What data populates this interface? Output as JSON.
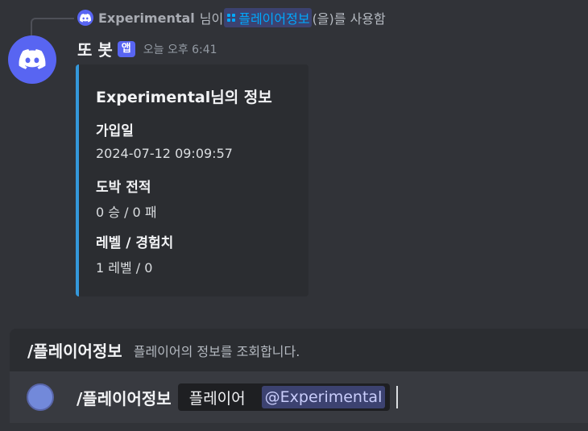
{
  "reply": {
    "user": "Experimental",
    "text_before": "님이",
    "command": "플레이어정보",
    "text_after": "(을)를 사용함"
  },
  "message": {
    "username": "또 봇",
    "app_tag": "앱",
    "timestamp": "오늘 오후 6:41"
  },
  "embed": {
    "accent_color": "#3498db",
    "title": "Experimental님의 정보",
    "fields": [
      {
        "name": "가입일",
        "value": "2024-07-12 09:09:57"
      },
      {
        "name": "도박 전적",
        "value": "0 승 / 0 패"
      },
      {
        "name": "레벨 / 경험치",
        "value": "1 레벨 / 0"
      }
    ]
  },
  "command_suggestion": {
    "name": "/플레이어정보",
    "description": "플레이어의 정보를 조회합니다."
  },
  "input": {
    "command": "/플레이어정보",
    "option_name": "플레이어",
    "option_value": "@Experimental"
  },
  "icons": {
    "bot_avatar": "discord-logo-icon",
    "reply_avatar": "discord-logo-icon",
    "command_chip": "app-grid-icon"
  },
  "colors": {
    "background": "#313338",
    "brand": "#5865f2",
    "link": "#00a8fc"
  }
}
